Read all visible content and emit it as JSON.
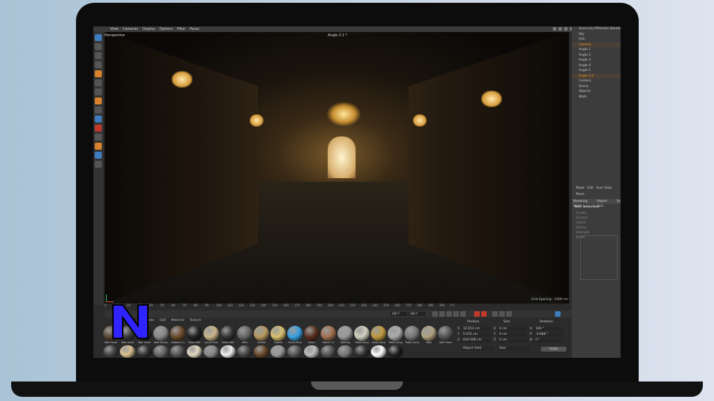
{
  "menubar": {
    "items": [
      "View",
      "Cameras",
      "Display",
      "Options",
      "Filter",
      "Panel"
    ]
  },
  "viewport": {
    "label": "Perspective",
    "camera": "Angle 2.1 *",
    "grid_spacing": "Grid Spacing : 1000 cm"
  },
  "object_manager": {
    "items": [
      {
        "label": "Scene by Efthimios Skemberis",
        "selected": false
      },
      {
        "label": "Sky",
        "selected": false
      },
      {
        "label": "Info",
        "selected": false
      },
      {
        "label": "Camera",
        "selected": true
      },
      {
        "label": "Angle 1",
        "selected": false
      },
      {
        "label": "Angle 2",
        "selected": false
      },
      {
        "label": "Angle 3",
        "selected": false
      },
      {
        "label": "Angle 4",
        "selected": false
      },
      {
        "label": "Angle 5",
        "selected": false
      },
      {
        "label": "Angle 2.1",
        "selected": true
      },
      {
        "label": "Camera",
        "selected": false
      },
      {
        "label": "Scene",
        "selected": false
      },
      {
        "label": "Objects",
        "selected": false
      },
      {
        "label": "Walls",
        "selected": false
      }
    ]
  },
  "attributes": {
    "tabs": [
      "Mode",
      "Edit",
      "User Data"
    ],
    "mode": "Move",
    "subtabs": [
      "Modeling Axis",
      "Object Axis",
      "So"
    ],
    "section": "Soft Selection",
    "props": [
      "Enable",
      "Surface",
      "Falloff",
      "Radius",
      "Strength",
      "Width"
    ],
    "graph_labels": [
      "1.0",
      "0.8",
      "0.6",
      "0.4",
      "0.2",
      "0.0",
      "0.5",
      "1.0"
    ]
  },
  "timeline": {
    "ticks": [
      "0",
      "10",
      "20",
      "30",
      "40",
      "50",
      "60",
      "70",
      "80",
      "90",
      "100",
      "110",
      "120",
      "130",
      "140",
      "150",
      "160",
      "170",
      "180",
      "190",
      "200",
      "210",
      "220",
      "230",
      "240",
      "250",
      "260",
      "270",
      "280",
      "290",
      "300"
    ],
    "end_label": "0 F",
    "frame_current": "300 F",
    "frame_end": "300 F"
  },
  "materials": {
    "menu": [
      "Create",
      "Edit",
      "Material",
      "Texture"
    ],
    "row1": [
      {
        "name": "Wall Panel",
        "color": "#5a4630"
      },
      {
        "name": "Wall Panel",
        "color": "#3a3a3a"
      },
      {
        "name": "Wall Panel",
        "color": "#2a2a2a"
      },
      {
        "name": "Wall Decals",
        "color": "#888888"
      },
      {
        "name": "Rubbed Cu",
        "color": "#6b4a2b"
      },
      {
        "name": "Black Met",
        "color": "#222222"
      },
      {
        "name": "Lamp Shac",
        "color": "#c9b48a"
      },
      {
        "name": "Black Met",
        "color": "#333333"
      },
      {
        "name": "Wire",
        "color": "#666666"
      },
      {
        "name": "Candle",
        "color": "#b59a60"
      },
      {
        "name": "Flames",
        "color": "#d8c070"
      },
      {
        "name": "Flame Blue",
        "color": "#38a0e0"
      },
      {
        "name": "Fabric",
        "color": "#5a3020"
      },
      {
        "name": "Fabric 2.1",
        "color": "#a07050"
      },
      {
        "name": "Painting",
        "color": "#9a9a9a"
      },
      {
        "name": "Table Lamp",
        "color": "#d0d0c0"
      },
      {
        "name": "Desk Lamp",
        "color": "#c09a40"
      },
      {
        "name": "Table Lamp",
        "color": "#aaaaaa"
      },
      {
        "name": "Table Lamp",
        "color": "#777777"
      },
      {
        "name": "Wall",
        "color": "#b0a080"
      },
      {
        "name": "Wall Glass",
        "color": "#555555"
      }
    ],
    "row2_colors": [
      "#444",
      "#d8c090",
      "#333",
      "#666",
      "#555",
      "#e0d8c0",
      "#888",
      "#eeeeee",
      "#444",
      "#6b4a2b",
      "#999",
      "#555",
      "#bbb",
      "#555",
      "#777",
      "#333",
      "#ffffff",
      "#222"
    ]
  },
  "coordinates": {
    "headers": [
      "Position",
      "Size",
      "Rotation"
    ],
    "rows": [
      {
        "axis": "X",
        "pos": "32.653 cm",
        "size": "0 cm",
        "rot_axis": "H",
        "rot": "180 °"
      },
      {
        "axis": "Y",
        "pos": "5.635 cm",
        "size": "0 cm",
        "rot_axis": "P",
        "rot": "-0.688 °"
      },
      {
        "axis": "Z",
        "pos": "834.908 cm",
        "size": "0 cm",
        "rot_axis": "B",
        "rot": "0 °"
      }
    ],
    "mode": "Object (Rel)",
    "size_mode": "Size",
    "apply": "Apply"
  }
}
